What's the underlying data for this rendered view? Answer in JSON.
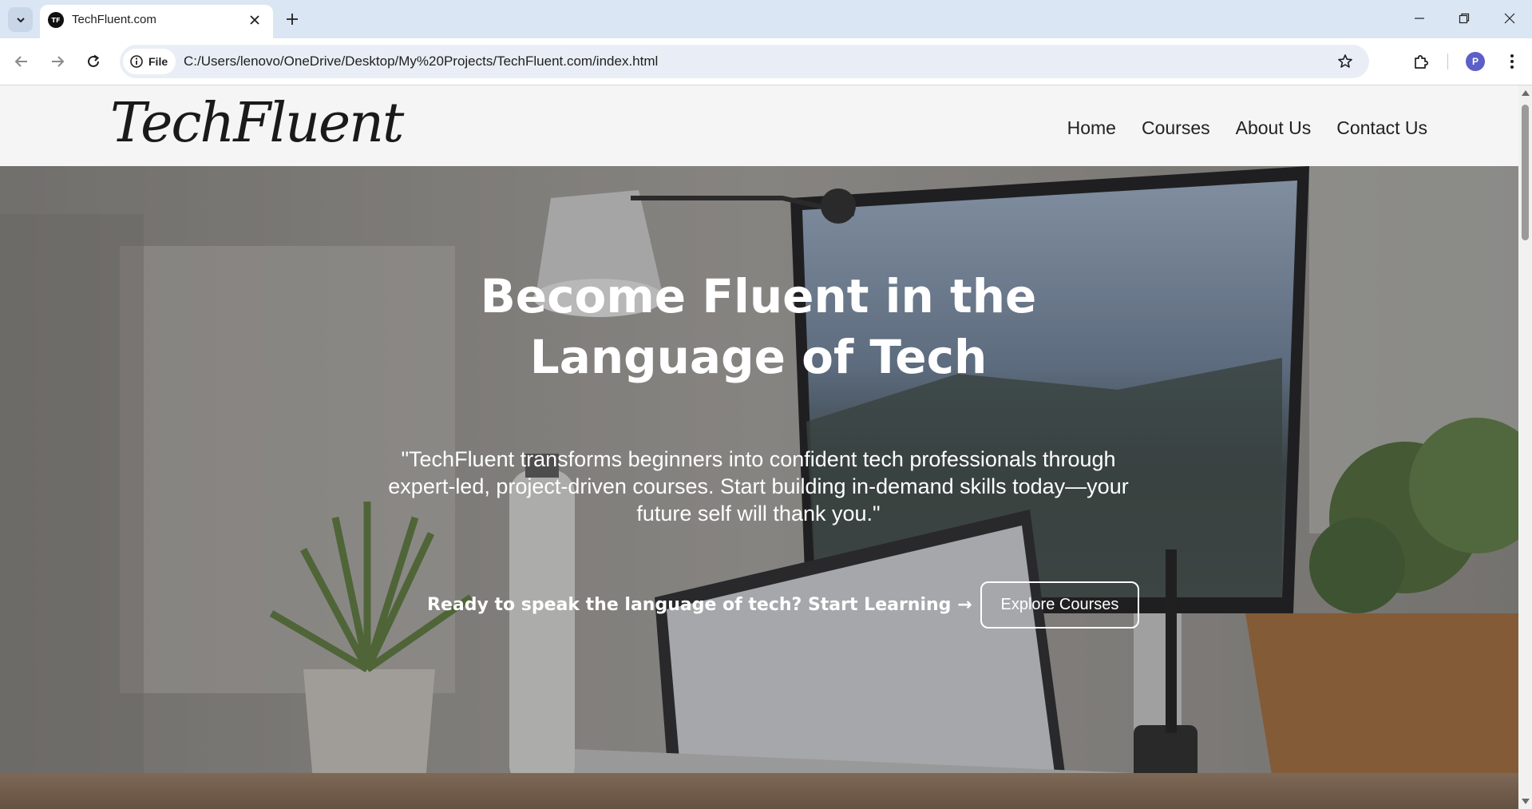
{
  "browser": {
    "tab_title": "TechFluent.com",
    "favicon_text": "TF",
    "site_info_label": "File",
    "url": "C:/Users/lenovo/OneDrive/Desktop/My%20Projects/TechFluent.com/index.html",
    "profile_initial": "P"
  },
  "site": {
    "logo": "TechFluent",
    "nav": [
      "Home",
      "Courses",
      "About Us",
      "Contact Us"
    ]
  },
  "hero": {
    "title_line1": "Become Fluent in the",
    "title_line2": "Language of Tech",
    "quote": "\"TechFluent transforms beginners into confident tech professionals through expert-led, project-driven courses. Start building in-demand skills today—your future self will thank you.\"",
    "cta_text": "Ready to speak the language of tech? Start Learning →",
    "cta_button": "Explore Courses"
  },
  "colors": {
    "tabstrip": "#dbe6f4",
    "header_bg": "#f5f5f5",
    "hero_text": "#ffffff"
  }
}
